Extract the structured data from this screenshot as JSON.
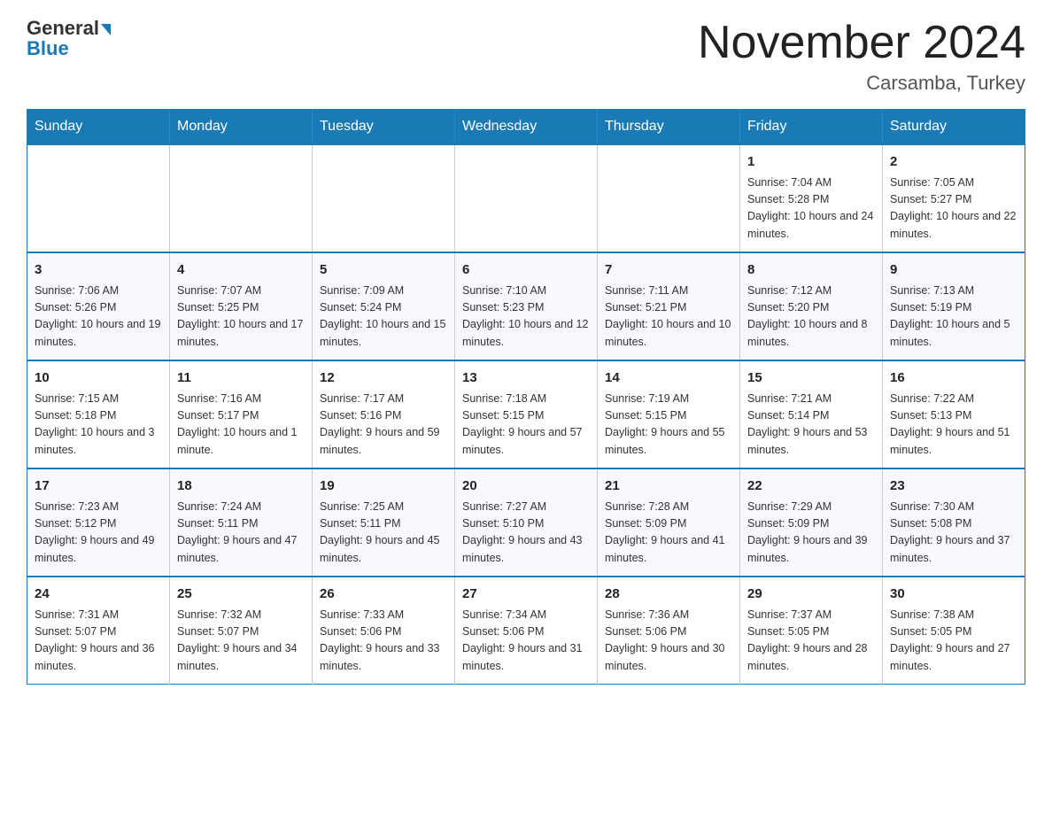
{
  "header": {
    "logo_general": "General",
    "logo_blue": "Blue",
    "month_title": "November 2024",
    "location": "Carsamba, Turkey"
  },
  "days_of_week": [
    "Sunday",
    "Monday",
    "Tuesday",
    "Wednesday",
    "Thursday",
    "Friday",
    "Saturday"
  ],
  "weeks": [
    [
      {
        "day": "",
        "sunrise": "",
        "sunset": "",
        "daylight": ""
      },
      {
        "day": "",
        "sunrise": "",
        "sunset": "",
        "daylight": ""
      },
      {
        "day": "",
        "sunrise": "",
        "sunset": "",
        "daylight": ""
      },
      {
        "day": "",
        "sunrise": "",
        "sunset": "",
        "daylight": ""
      },
      {
        "day": "",
        "sunrise": "",
        "sunset": "",
        "daylight": ""
      },
      {
        "day": "1",
        "sunrise": "Sunrise: 7:04 AM",
        "sunset": "Sunset: 5:28 PM",
        "daylight": "Daylight: 10 hours and 24 minutes."
      },
      {
        "day": "2",
        "sunrise": "Sunrise: 7:05 AM",
        "sunset": "Sunset: 5:27 PM",
        "daylight": "Daylight: 10 hours and 22 minutes."
      }
    ],
    [
      {
        "day": "3",
        "sunrise": "Sunrise: 7:06 AM",
        "sunset": "Sunset: 5:26 PM",
        "daylight": "Daylight: 10 hours and 19 minutes."
      },
      {
        "day": "4",
        "sunrise": "Sunrise: 7:07 AM",
        "sunset": "Sunset: 5:25 PM",
        "daylight": "Daylight: 10 hours and 17 minutes."
      },
      {
        "day": "5",
        "sunrise": "Sunrise: 7:09 AM",
        "sunset": "Sunset: 5:24 PM",
        "daylight": "Daylight: 10 hours and 15 minutes."
      },
      {
        "day": "6",
        "sunrise": "Sunrise: 7:10 AM",
        "sunset": "Sunset: 5:23 PM",
        "daylight": "Daylight: 10 hours and 12 minutes."
      },
      {
        "day": "7",
        "sunrise": "Sunrise: 7:11 AM",
        "sunset": "Sunset: 5:21 PM",
        "daylight": "Daylight: 10 hours and 10 minutes."
      },
      {
        "day": "8",
        "sunrise": "Sunrise: 7:12 AM",
        "sunset": "Sunset: 5:20 PM",
        "daylight": "Daylight: 10 hours and 8 minutes."
      },
      {
        "day": "9",
        "sunrise": "Sunrise: 7:13 AM",
        "sunset": "Sunset: 5:19 PM",
        "daylight": "Daylight: 10 hours and 5 minutes."
      }
    ],
    [
      {
        "day": "10",
        "sunrise": "Sunrise: 7:15 AM",
        "sunset": "Sunset: 5:18 PM",
        "daylight": "Daylight: 10 hours and 3 minutes."
      },
      {
        "day": "11",
        "sunrise": "Sunrise: 7:16 AM",
        "sunset": "Sunset: 5:17 PM",
        "daylight": "Daylight: 10 hours and 1 minute."
      },
      {
        "day": "12",
        "sunrise": "Sunrise: 7:17 AM",
        "sunset": "Sunset: 5:16 PM",
        "daylight": "Daylight: 9 hours and 59 minutes."
      },
      {
        "day": "13",
        "sunrise": "Sunrise: 7:18 AM",
        "sunset": "Sunset: 5:15 PM",
        "daylight": "Daylight: 9 hours and 57 minutes."
      },
      {
        "day": "14",
        "sunrise": "Sunrise: 7:19 AM",
        "sunset": "Sunset: 5:15 PM",
        "daylight": "Daylight: 9 hours and 55 minutes."
      },
      {
        "day": "15",
        "sunrise": "Sunrise: 7:21 AM",
        "sunset": "Sunset: 5:14 PM",
        "daylight": "Daylight: 9 hours and 53 minutes."
      },
      {
        "day": "16",
        "sunrise": "Sunrise: 7:22 AM",
        "sunset": "Sunset: 5:13 PM",
        "daylight": "Daylight: 9 hours and 51 minutes."
      }
    ],
    [
      {
        "day": "17",
        "sunrise": "Sunrise: 7:23 AM",
        "sunset": "Sunset: 5:12 PM",
        "daylight": "Daylight: 9 hours and 49 minutes."
      },
      {
        "day": "18",
        "sunrise": "Sunrise: 7:24 AM",
        "sunset": "Sunset: 5:11 PM",
        "daylight": "Daylight: 9 hours and 47 minutes."
      },
      {
        "day": "19",
        "sunrise": "Sunrise: 7:25 AM",
        "sunset": "Sunset: 5:11 PM",
        "daylight": "Daylight: 9 hours and 45 minutes."
      },
      {
        "day": "20",
        "sunrise": "Sunrise: 7:27 AM",
        "sunset": "Sunset: 5:10 PM",
        "daylight": "Daylight: 9 hours and 43 minutes."
      },
      {
        "day": "21",
        "sunrise": "Sunrise: 7:28 AM",
        "sunset": "Sunset: 5:09 PM",
        "daylight": "Daylight: 9 hours and 41 minutes."
      },
      {
        "day": "22",
        "sunrise": "Sunrise: 7:29 AM",
        "sunset": "Sunset: 5:09 PM",
        "daylight": "Daylight: 9 hours and 39 minutes."
      },
      {
        "day": "23",
        "sunrise": "Sunrise: 7:30 AM",
        "sunset": "Sunset: 5:08 PM",
        "daylight": "Daylight: 9 hours and 37 minutes."
      }
    ],
    [
      {
        "day": "24",
        "sunrise": "Sunrise: 7:31 AM",
        "sunset": "Sunset: 5:07 PM",
        "daylight": "Daylight: 9 hours and 36 minutes."
      },
      {
        "day": "25",
        "sunrise": "Sunrise: 7:32 AM",
        "sunset": "Sunset: 5:07 PM",
        "daylight": "Daylight: 9 hours and 34 minutes."
      },
      {
        "day": "26",
        "sunrise": "Sunrise: 7:33 AM",
        "sunset": "Sunset: 5:06 PM",
        "daylight": "Daylight: 9 hours and 33 minutes."
      },
      {
        "day": "27",
        "sunrise": "Sunrise: 7:34 AM",
        "sunset": "Sunset: 5:06 PM",
        "daylight": "Daylight: 9 hours and 31 minutes."
      },
      {
        "day": "28",
        "sunrise": "Sunrise: 7:36 AM",
        "sunset": "Sunset: 5:06 PM",
        "daylight": "Daylight: 9 hours and 30 minutes."
      },
      {
        "day": "29",
        "sunrise": "Sunrise: 7:37 AM",
        "sunset": "Sunset: 5:05 PM",
        "daylight": "Daylight: 9 hours and 28 minutes."
      },
      {
        "day": "30",
        "sunrise": "Sunrise: 7:38 AM",
        "sunset": "Sunset: 5:05 PM",
        "daylight": "Daylight: 9 hours and 27 minutes."
      }
    ]
  ]
}
